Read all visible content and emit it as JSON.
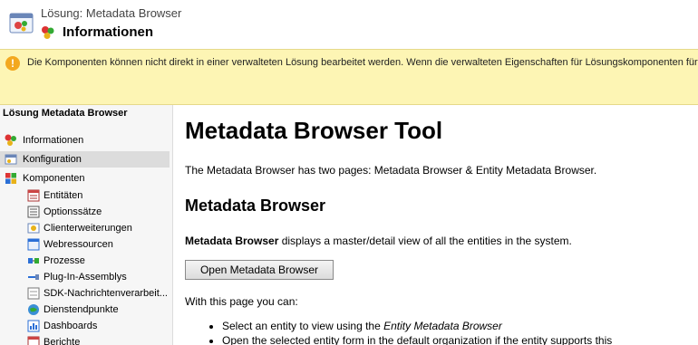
{
  "header": {
    "solution_label": "Lösung: Metadata Browser",
    "page_title": "Informationen"
  },
  "notice": {
    "icon": "warning-icon",
    "text": "Die Komponenten können nicht direkt in einer verwalteten Lösung bearbeitet werden. Wenn die verwalteten Eigenschaften für Lösungskomponenten für"
  },
  "sidebar": {
    "title": "Lösung Metadata Browser",
    "items": [
      {
        "label": "Informationen",
        "icon": "info-icon"
      },
      {
        "label": "Konfiguration",
        "icon": "configuration-icon"
      },
      {
        "label": "Komponenten",
        "icon": "components-icon"
      },
      {
        "label": "Entitäten",
        "icon": "entities-icon"
      },
      {
        "label": "Optionssätze",
        "icon": "option-sets-icon"
      },
      {
        "label": "Clienterweiterungen",
        "icon": "client-extensions-icon"
      },
      {
        "label": "Webressourcen",
        "icon": "web-resources-icon"
      },
      {
        "label": "Prozesse",
        "icon": "processes-icon"
      },
      {
        "label": "Plug-In-Assemblys",
        "icon": "plugin-assemblies-icon"
      },
      {
        "label": "SDK-Nachrichtenverarbeit...",
        "icon": "sdk-messages-icon"
      },
      {
        "label": "Dienstendpunkte",
        "icon": "service-endpoints-icon"
      },
      {
        "label": "Dashboards",
        "icon": "dashboards-icon"
      },
      {
        "label": "Berichte",
        "icon": "reports-icon"
      }
    ]
  },
  "main": {
    "title": "Metadata Browser Tool",
    "intro": "The Metadata Browser has two pages: Metadata Browser & Entity Metadata Browser.",
    "section_title": "Metadata Browser",
    "desc_bold": "Metadata Browser",
    "desc_rest": " displays a master/detail view of all the entities in the system.",
    "button_label": "Open Metadata Browser",
    "can_text": "With this page you can:",
    "bullets": [
      {
        "text": "Select an entity to view using the ",
        "em": "Entity Metadata Browser"
      },
      {
        "text": "Open the selected entity form in the default organization if the entity supports this",
        "em": ""
      }
    ]
  }
}
